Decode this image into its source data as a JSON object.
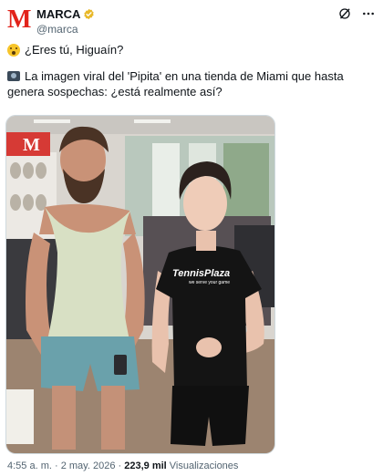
{
  "author": {
    "logo_letter": "M",
    "name": "MARCA",
    "handle": "@marca",
    "brand_color": "#e2231a",
    "verified_color": "#e8b829"
  },
  "tweet": {
    "line1": "¿Eres tú, Higuaín?",
    "line1_icon": "astonished-face-emoji",
    "line2": "La imagen viral del 'Pipita' en una tienda de Miami que hasta genera sospechas: ¿está realmente así?",
    "line2_icon": "camera-emoji"
  },
  "photo": {
    "store_logo": "M",
    "shirt_brand": "TennisPlaza",
    "shirt_tagline": "we serve your game"
  },
  "meta": {
    "time": "4:55 a. m.",
    "sep1": "·",
    "date": "2 may. 2026",
    "sep2": "·",
    "views_count": "223,9 mil",
    "views_label": "Visualizaciones"
  }
}
